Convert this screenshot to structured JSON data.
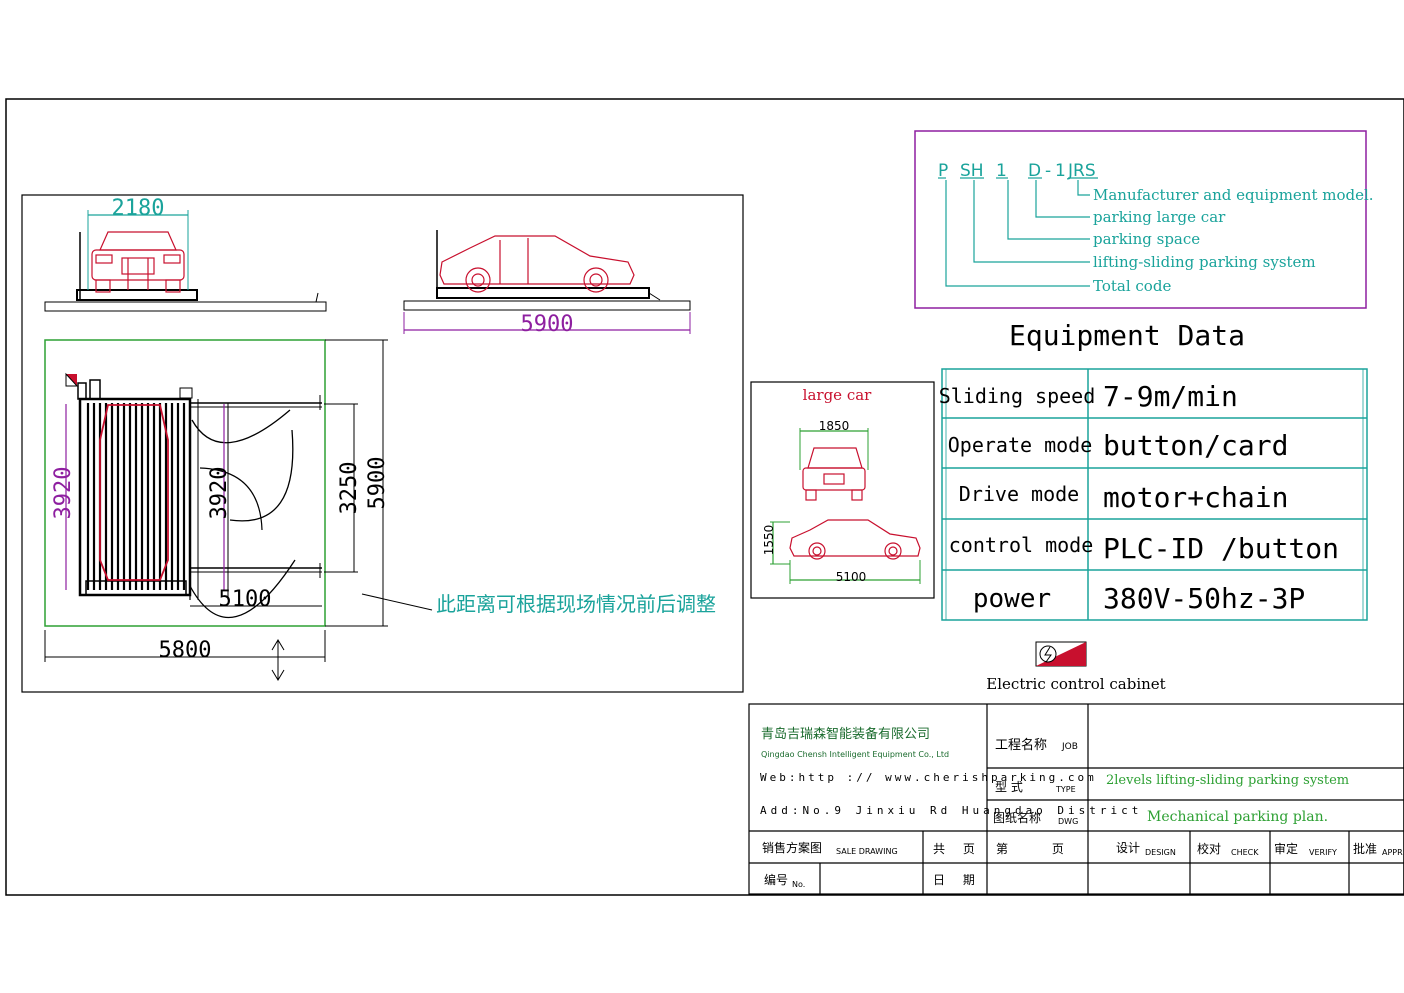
{
  "dimensions": {
    "side_width": "2180",
    "front_length": "5900",
    "plan_height_left": "3920",
    "plan_height_mid": "3920",
    "plan_inner": "3250",
    "plan_outer": "5900",
    "plan_gap": "5100",
    "plan_width": "5800"
  },
  "note_cn": "此距离可根据现场情况前后调整",
  "model_code": {
    "parts": [
      "P",
      "SH",
      "1",
      "D",
      "-",
      "1",
      "JRS"
    ],
    "legend": [
      "Manufacturer and equipment model.",
      "parking large car",
      "parking space",
      "lifting-sliding parking system",
      "Total code"
    ]
  },
  "equipment": {
    "title": "Equipment Data",
    "rows": [
      {
        "label": "Sliding speed",
        "value": "7-9m/min"
      },
      {
        "label": "Operate mode",
        "value": "button/card"
      },
      {
        "label": "Drive mode",
        "value": "motor+chain"
      },
      {
        "label": "control mode",
        "value": "PLC-ID /button"
      },
      {
        "label": "power",
        "value": "380V-50hz-3P"
      }
    ]
  },
  "large_car": {
    "title": "large car",
    "width": "1850",
    "height": "1550",
    "length": "5100"
  },
  "cabinet_label": "Electric control cabinet",
  "title_block": {
    "company_cn": "青岛吉瑞森智能装备有限公司",
    "company_en": "Qingdao Chensh Intelligent Equipment Co., Ltd",
    "web": "Web:http :// www.cherishparking.com",
    "address": "Add:No.9 Jinxiu Rd Huangdao District",
    "job_cn": "工程名称",
    "job_en": "JOB",
    "type_cn": "型 式",
    "type_en": "TYPE",
    "type_value": "2levels lifting-sliding parking system",
    "dwg_cn": "图纸名称",
    "dwg_en": "DWG",
    "dwg_value": "Mechanical parking plan.",
    "sale_cn": "销售方案图",
    "sale_en": "SALE DRAWING",
    "total_pages": "共 页",
    "page_no": "第 页",
    "design_cn": "设计",
    "design_en": "DESIGN",
    "check_cn": "校对",
    "check_en": "CHECK",
    "verify_cn": "审定",
    "verify_en": "VERIFY",
    "approve_cn": "批准",
    "approve_en": "APPR",
    "no_cn": "编号",
    "no_en": "No.",
    "date_cn": "日 期"
  }
}
